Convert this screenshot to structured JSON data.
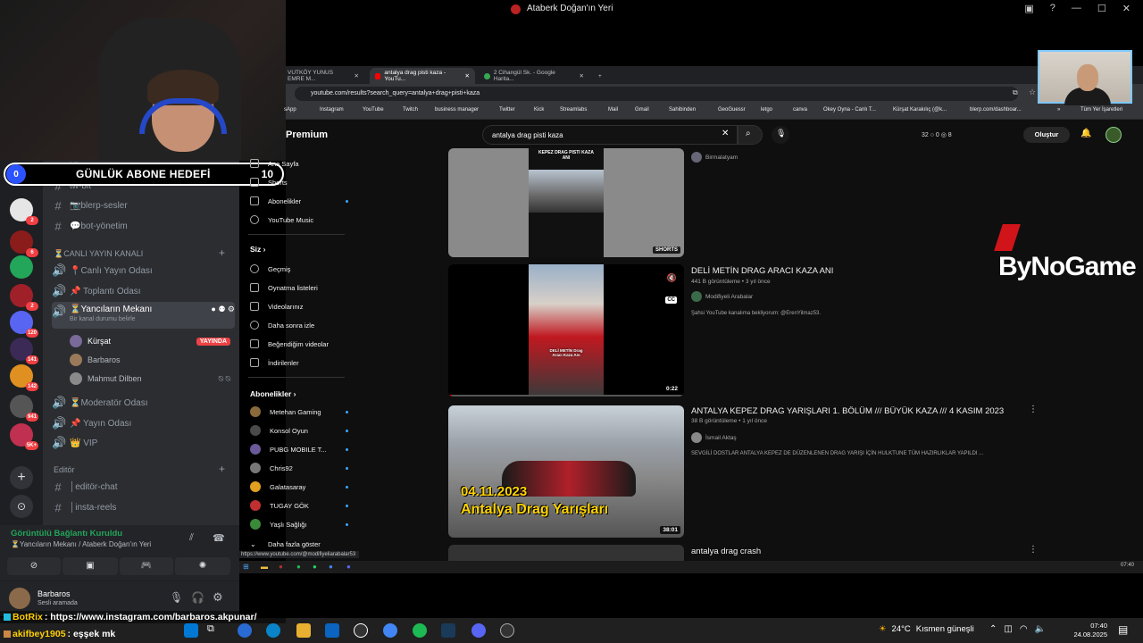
{
  "window": {
    "title": "Ataberk Doğan'ın Yeri",
    "controls": [
      "—",
      "☐",
      "✕"
    ]
  },
  "goal": {
    "current": "0",
    "label": "GÜNLÜK ABONE HEDEFİ",
    "target": "10"
  },
  "discord": {
    "servers": [
      {
        "badge": ""
      },
      {
        "badge": "2"
      },
      {
        "badge": "6"
      },
      {
        "badge": ""
      },
      {
        "badge": "2"
      },
      {
        "badge": "120"
      },
      {
        "badge": "141"
      },
      {
        "badge": "142"
      },
      {
        "badge": "941"
      },
      {
        "badge": "5K+"
      }
    ],
    "channels_top": [
      {
        "name": "klip"
      },
      {
        "name": "tw-bit"
      },
      {
        "name": "📷blerp-sesler"
      },
      {
        "name": "💬bot-yönetim"
      }
    ],
    "category_live": "⏳CANLI YAYIN KANALI",
    "voice_channels": [
      {
        "name": "📍Canlı Yayın Odası"
      },
      {
        "name": "📌 Toplantı Odası"
      }
    ],
    "active_channel": {
      "name": "⏳Yancıların Mekanı",
      "status": "Bir kanal durumu belirle"
    },
    "members": [
      {
        "name": "Kürşat",
        "live": "YAYINDA"
      },
      {
        "name": "Barbaros",
        "live": ""
      },
      {
        "name": "Mahmut Dilben",
        "live": ""
      }
    ],
    "voice_channels_2": [
      {
        "name": "⏳Moderatör Odası"
      },
      {
        "name": "📌 Yayın Odası"
      },
      {
        "name": "👑 VIP"
      }
    ],
    "category_editor": "Editör",
    "editor_channels": [
      {
        "name": "│editör-chat"
      },
      {
        "name": "│insta-reels"
      }
    ],
    "voice": {
      "status": "Görüntülü Bağlantı Kuruldu",
      "location": "⏳Yancıların Mekanı / Ataberk Doğan'ın Yeri"
    },
    "user": {
      "name": "Barbaros",
      "status": "Sesli aramada"
    }
  },
  "browser": {
    "tabs": [
      {
        "label": "VUTKÖY YUNUS EMRE M..."
      },
      {
        "label": "antalya drag pisti kaza - YouTu..."
      },
      {
        "label": "2 Cihangül Sk. - Google Harita..."
      }
    ],
    "url": "youtube.com/results?search_query=antalya+drag+pisti+kaza",
    "bookmarks": [
      "sApp",
      "Instagram",
      "YouTube",
      "Twitch",
      "business manager",
      "Twitter",
      "Kick",
      "Streamlabs",
      "Mail",
      "Gmail",
      "Sahibinden",
      "GeoGuessr",
      "letgo",
      "canva",
      "Okey Oyna - Canlı T...",
      "Kürşat Karakılıç (@k...",
      "blerp.com/dashboar..."
    ],
    "all_bookmarks": "Tüm Yer İşaretleri",
    "status_url": "https://www.youtube.com/@modifiyeliarabalar53"
  },
  "youtube": {
    "logo": "Premium",
    "search_query": "antalya drag pisti kaza",
    "stats": "32 ○ 0 ◎ 8",
    "create": "Oluştur",
    "nav": [
      {
        "label": "Ana Sayfa"
      },
      {
        "label": "Shorts"
      },
      {
        "label": "Abonelikler"
      },
      {
        "label": "YouTube Music"
      }
    ],
    "you_section": "Siz",
    "you_items": [
      {
        "label": "Geçmiş"
      },
      {
        "label": "Oynatma listeleri"
      },
      {
        "label": "Videolarınız"
      },
      {
        "label": "Daha sonra izle"
      },
      {
        "label": "Beğendiğim videolar"
      },
      {
        "label": "İndirilenler"
      }
    ],
    "subs_section": "Abonelikler",
    "subscriptions": [
      {
        "label": "Metehan Gaming"
      },
      {
        "label": "Konsol Oyun"
      },
      {
        "label": "PUBG MOBILE T..."
      },
      {
        "label": "Chris92"
      },
      {
        "label": "Galatasaray"
      },
      {
        "label": "TUGAY GÖK"
      },
      {
        "label": "Yaşlı Sağlığı"
      }
    ],
    "show_more": "Daha fazla göster",
    "results": [
      {
        "thumb_text": "KEPEZ DRAG PISTI KAZA ANI",
        "badge": "SHORTS",
        "channel": "Birmalatyam"
      },
      {
        "title": "DELİ METİN DRAG ARACI KAZA ANI",
        "meta": "441 B görüntüleme • 3 yıl önce",
        "channel": "Modifiyeli Arabalar",
        "desc": "Şahsi YouTube kanalıma bekliyorum: @ErenYilmaz53.",
        "thumb_text": "DELİ METİN Drag Aracı Kaza Anı",
        "duration": "0:22"
      },
      {
        "title": "ANTALYA KEPEZ DRAG YARIŞLARI 1. BÖLÜM /// BÜYÜK KAZA /// 4 KASIM 2023",
        "meta": "38 B görüntüleme • 1 yıl önce",
        "channel": "İsmail Aktaş",
        "desc": "SEVGİLİ DOSTLAR ANTALYA KEPEZ DE DÜZENLENEN DRAG YARIŞI İÇİN HULKTUNE TÜM HAZIRLIKLAR YAPILDI ...",
        "thumb_date": "04.11.2023",
        "thumb_text": "Antalya Drag Yarışları",
        "duration": "38:01"
      },
      {
        "title": "antalya drag crash"
      }
    ]
  },
  "overlay": {
    "bynogame": "ByNoGame"
  },
  "inner_taskbar": {
    "time": "07:40"
  },
  "chat": [
    {
      "user": "BotRix",
      "message": ": https://www.instagram.com/barbaros.akpunar/"
    },
    {
      "user": "akifbey1905",
      "message": ": eşşek mk"
    }
  ],
  "taskbar": {
    "temperature": "24°C",
    "weather": "Kısmen güneşli",
    "time": "07:40",
    "date": "24.08.2025"
  }
}
